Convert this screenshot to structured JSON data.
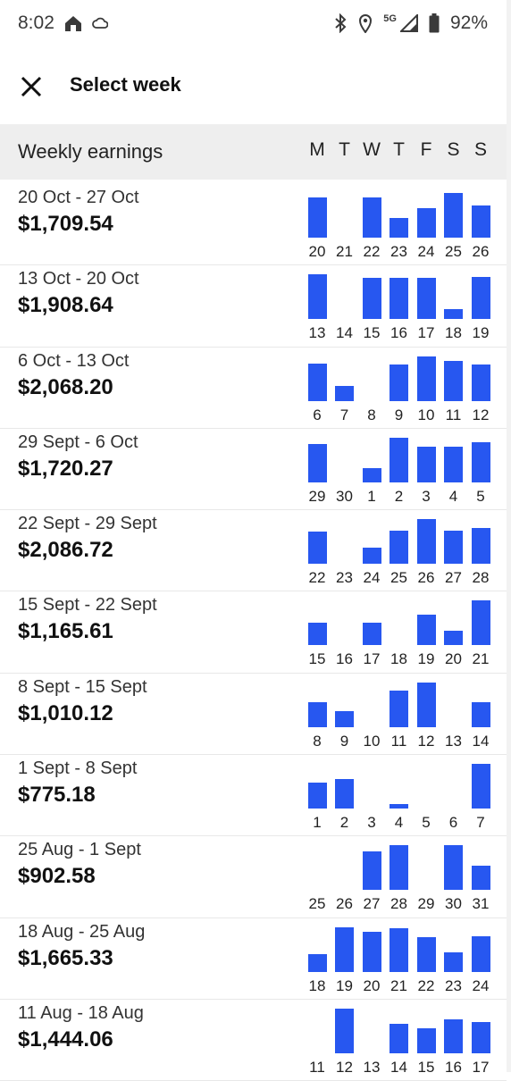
{
  "status_bar": {
    "time": "8:02",
    "network": "5G",
    "battery": "92%",
    "icons": [
      "home-icon",
      "cloud-icon",
      "bluetooth-icon",
      "location-icon",
      "signal-icon",
      "battery-icon"
    ]
  },
  "header": {
    "title": "Select week",
    "close_icon": "close-icon"
  },
  "columns": {
    "title": "Weekly earnings",
    "day_letters": [
      "M",
      "T",
      "W",
      "T",
      "F",
      "S",
      "S"
    ]
  },
  "colors": {
    "bar": "#2757f0",
    "header_bg": "#eeeeee"
  },
  "weeks": [
    {
      "range": "20 Oct - 27 Oct",
      "total": "$1,709.54",
      "days": [
        "20",
        "21",
        "22",
        "23",
        "24",
        "25",
        "26"
      ],
      "levels": [
        0.9,
        0,
        0.9,
        0.43,
        0.66,
        1.0,
        0.72
      ]
    },
    {
      "range": "13 Oct - 20 Oct",
      "total": "$1,908.64",
      "days": [
        "13",
        "14",
        "15",
        "16",
        "17",
        "18",
        "19"
      ],
      "levels": [
        1.0,
        0,
        0.92,
        0.92,
        0.92,
        0.22,
        0.94
      ]
    },
    {
      "range": "6 Oct - 13 Oct",
      "total": "$2,068.20",
      "days": [
        "6",
        "7",
        "8",
        "9",
        "10",
        "11",
        "12"
      ],
      "levels": [
        0.84,
        0.34,
        0,
        0.82,
        1.0,
        0.9,
        0.82
      ]
    },
    {
      "range": "29 Sept - 6 Oct",
      "total": "$1,720.27",
      "days": [
        "29",
        "30",
        "1",
        "2",
        "3",
        "4",
        "5"
      ],
      "levels": [
        0.86,
        0,
        0.32,
        1.0,
        0.8,
        0.8,
        0.9
      ]
    },
    {
      "range": "22 Sept - 29 Sept",
      "total": "$2,086.72",
      "days": [
        "22",
        "23",
        "24",
        "25",
        "26",
        "27",
        "28"
      ],
      "levels": [
        0.72,
        0,
        0.36,
        0.74,
        1.0,
        0.74,
        0.8
      ]
    },
    {
      "range": "15 Sept - 22 Sept",
      "total": "$1,165.61",
      "days": [
        "15",
        "16",
        "17",
        "18",
        "19",
        "20",
        "21"
      ],
      "levels": [
        0.5,
        0,
        0.5,
        0,
        0.68,
        0.32,
        1.0
      ]
    },
    {
      "range": "8 Sept - 15 Sept",
      "total": "$1,010.12",
      "days": [
        "8",
        "9",
        "10",
        "11",
        "12",
        "13",
        "14"
      ],
      "levels": [
        0.56,
        0.36,
        0,
        0.82,
        1.0,
        0,
        0.56
      ]
    },
    {
      "range": "1 Sept - 8 Sept",
      "total": "$775.18",
      "days": [
        "1",
        "2",
        "3",
        "4",
        "5",
        "6",
        "7"
      ],
      "levels": [
        0.58,
        0.66,
        0,
        0.1,
        0,
        0,
        1.0
      ]
    },
    {
      "range": "25 Aug - 1 Sept",
      "total": "$902.58",
      "days": [
        "25",
        "26",
        "27",
        "28",
        "29",
        "30",
        "31"
      ],
      "levels": [
        0,
        0,
        0.86,
        1.0,
        0,
        1.0,
        0.54
      ]
    },
    {
      "range": "18 Aug - 25 Aug",
      "total": "$1,665.33",
      "days": [
        "18",
        "19",
        "20",
        "21",
        "22",
        "23",
        "24"
      ],
      "levels": [
        0.4,
        1.0,
        0.9,
        0.98,
        0.78,
        0.44,
        0.8
      ]
    },
    {
      "range": "11 Aug - 18 Aug",
      "total": "$1,444.06",
      "days": [
        "11",
        "12",
        "13",
        "14",
        "15",
        "16",
        "17"
      ],
      "levels": [
        0,
        1.0,
        0,
        0.66,
        0.56,
        0.76,
        0.7
      ]
    }
  ]
}
